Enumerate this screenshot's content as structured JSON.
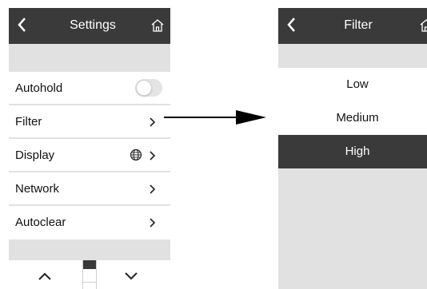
{
  "settings_screen": {
    "title": "Settings",
    "back_icon": "chevron-left-icon",
    "home_icon": "home-icon",
    "menu": [
      {
        "label": "Autohold",
        "control": "toggle",
        "toggle_on": false
      },
      {
        "label": "Filter",
        "control": "chevron"
      },
      {
        "label": "Display",
        "control": "chevron",
        "extra_icon": "globe-icon"
      },
      {
        "label": "Network",
        "control": "chevron"
      },
      {
        "label": "Autoclear",
        "control": "chevron"
      }
    ],
    "scroll": {
      "up_icon": "chevron-up-icon",
      "down_icon": "chevron-down-icon"
    }
  },
  "filter_screen": {
    "title": "Filter",
    "back_icon": "chevron-left-icon",
    "home_icon": "home-icon",
    "options": [
      "Low",
      "Medium",
      "High"
    ],
    "selected": "High"
  },
  "colors": {
    "titlebar": "#3a3a3a",
    "background": "#e1e1e1",
    "item": "#ffffff",
    "selected": "#3a3a3a"
  }
}
